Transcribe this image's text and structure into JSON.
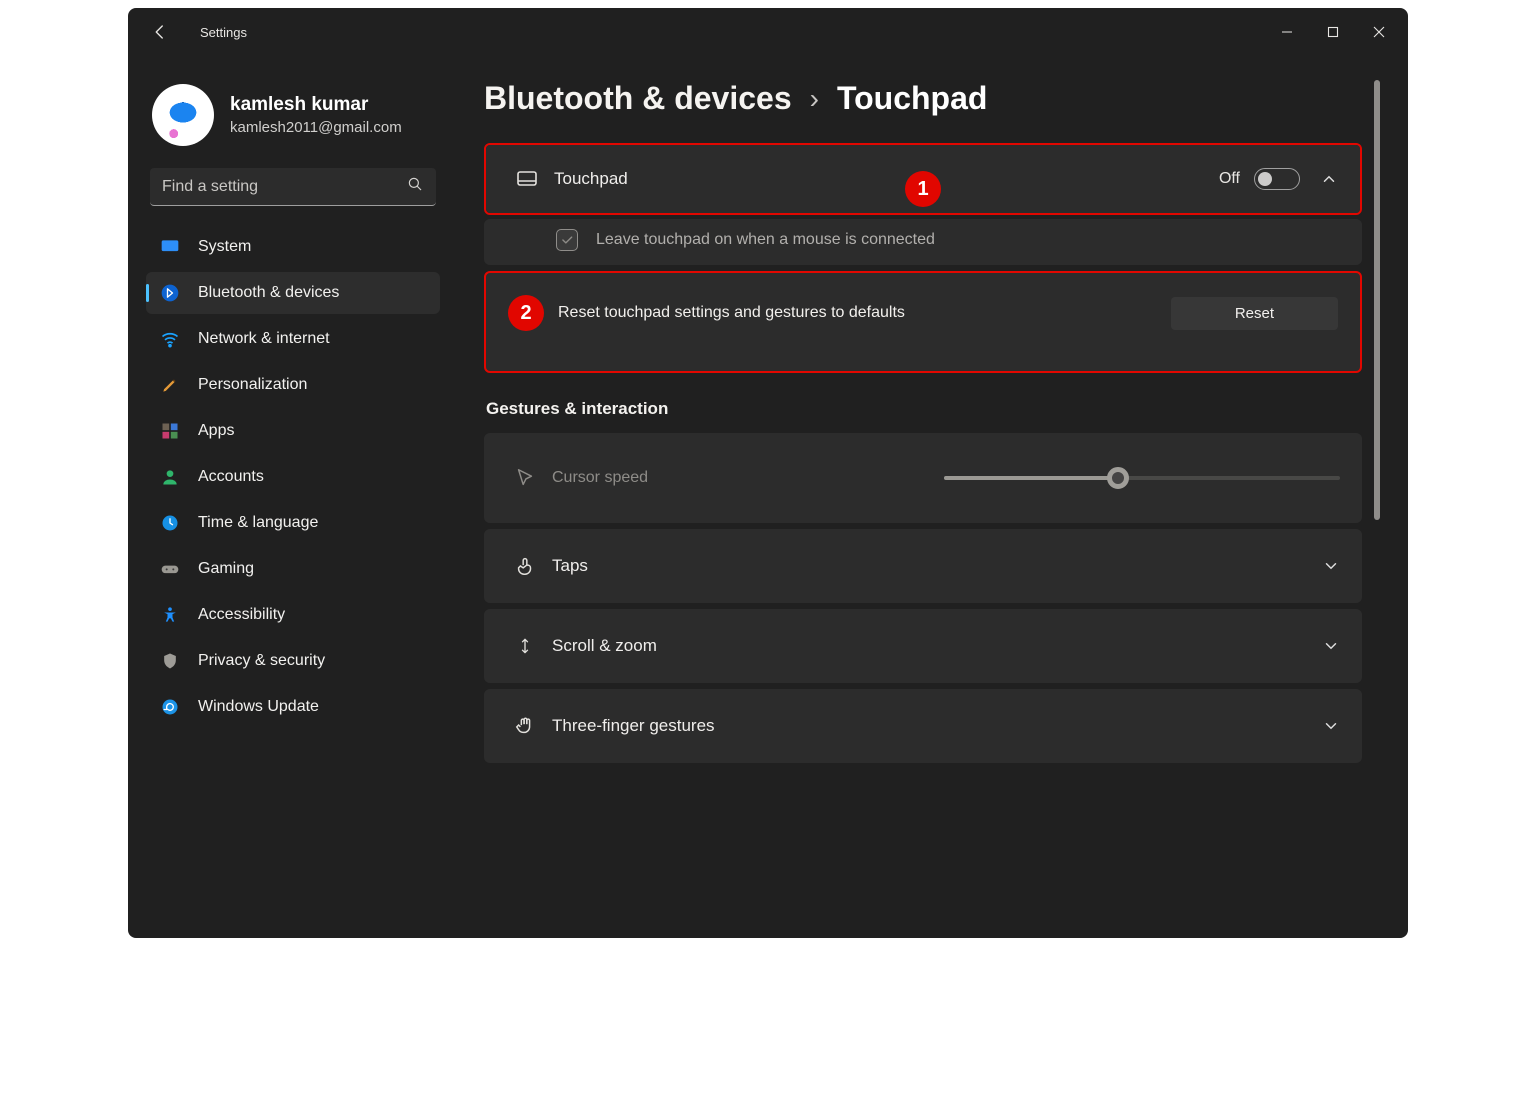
{
  "app_title": "Settings",
  "user": {
    "name": "kamlesh kumar",
    "email": "kamlesh2011@gmail.com"
  },
  "search": {
    "placeholder": "Find a setting"
  },
  "nav": [
    {
      "label": "System"
    },
    {
      "label": "Bluetooth & devices"
    },
    {
      "label": "Network & internet"
    },
    {
      "label": "Personalization"
    },
    {
      "label": "Apps"
    },
    {
      "label": "Accounts"
    },
    {
      "label": "Time & language"
    },
    {
      "label": "Gaming"
    },
    {
      "label": "Accessibility"
    },
    {
      "label": "Privacy & security"
    },
    {
      "label": "Windows Update"
    }
  ],
  "breadcrumb": {
    "parent": "Bluetooth & devices",
    "leaf": "Touchpad"
  },
  "touchpad": {
    "label": "Touchpad",
    "toggle_state": "Off",
    "leave_on_mouse": "Leave touchpad on when a mouse is connected",
    "reset_label": "Reset touchpad settings and gestures to defaults",
    "reset_button": "Reset"
  },
  "section_gestures": "Gestures & interaction",
  "items": {
    "cursor_speed": "Cursor speed",
    "taps": "Taps",
    "scroll_zoom": "Scroll & zoom",
    "three_finger": "Three-finger gestures"
  },
  "annotations": {
    "badge1": "1",
    "badge2": "2"
  },
  "colors": {
    "highlight": "#e20700",
    "badge": "#e10600",
    "accent": "#4cc2ff"
  }
}
